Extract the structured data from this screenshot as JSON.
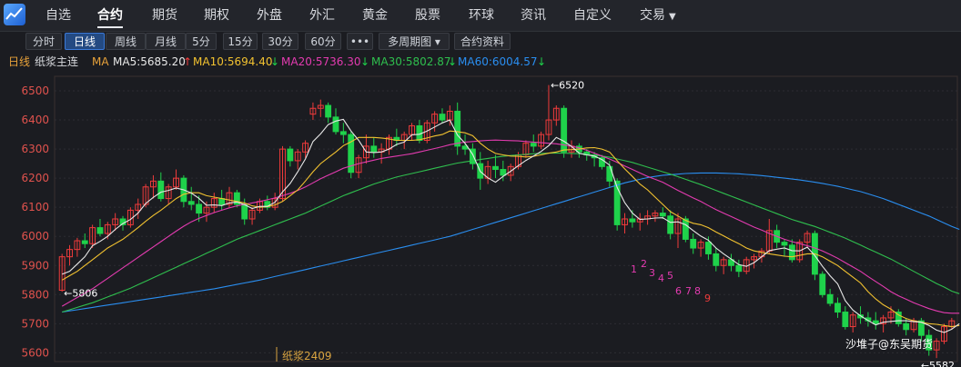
{
  "nav": {
    "items": [
      "自选",
      "合约",
      "期货",
      "期权",
      "外盘",
      "外汇",
      "黄金",
      "股票",
      "环球",
      "资讯",
      "自定义",
      "交易"
    ],
    "active": "合约"
  },
  "toolbar": {
    "expand_icon": "double-chevron-right-icon",
    "buttons": [
      "分时",
      "日线",
      "周线",
      "月线",
      "5分",
      "15分",
      "30分",
      "60分",
      "•••",
      "多周期图",
      "合约资料"
    ],
    "active": "日线"
  },
  "info": {
    "period": "日线",
    "contract": "纸浆主连",
    "ma_label": "MA",
    "ma5": "MA5:5685.20",
    "ma10": "MA10:5694.40",
    "ma20": "MA20:5736.30",
    "ma30": "MA30:5802.87",
    "ma60": "MA60:6004.57",
    "arrows": {
      "ma5": "↑",
      "ma10": "↓",
      "ma20": "↓",
      "ma30": "↓",
      "ma60": "↓"
    }
  },
  "colors": {
    "up": "#ef3b3b",
    "down": "#1fd24b",
    "ma5": "#e8e8e8",
    "ma10": "#f2c230",
    "ma20": "#e33bb0",
    "ma30": "#2fbf4e",
    "ma60": "#2a8ef0",
    "axis": "#e0524d"
  },
  "chart_data": {
    "type": "candlestick",
    "ylim": [
      5570,
      6550
    ],
    "y_ticks": [
      5600,
      5700,
      5800,
      5900,
      6000,
      6100,
      6200,
      6300,
      6400,
      6500
    ],
    "high_label": "←6520",
    "low_start_label": "←5806",
    "low_end_label": "←5582",
    "contract_label": "纸浆2409",
    "watermark": "沙堆子@东吴期货",
    "wave_labels": [
      "1",
      "2",
      "3",
      "4",
      "5",
      "6",
      "7",
      "8",
      "9"
    ],
    "candles": [
      [
        5815,
        5940,
        5810,
        5930
      ],
      [
        5930,
        5970,
        5900,
        5955
      ],
      [
        5955,
        5995,
        5930,
        5985
      ],
      [
        5985,
        6010,
        5960,
        5975
      ],
      [
        5975,
        6040,
        5960,
        6030
      ],
      [
        6030,
        6060,
        6000,
        6010
      ],
      [
        6010,
        6050,
        5990,
        6040
      ],
      [
        6040,
        6080,
        6020,
        6060
      ],
      [
        6060,
        6070,
        6020,
        6040
      ],
      [
        6040,
        6100,
        6030,
        6090
      ],
      [
        6090,
        6130,
        6060,
        6110
      ],
      [
        6110,
        6180,
        6100,
        6170
      ],
      [
        6170,
        6210,
        6130,
        6190
      ],
      [
        6190,
        6220,
        6120,
        6130
      ],
      [
        6130,
        6180,
        6110,
        6170
      ],
      [
        6170,
        6230,
        6160,
        6200
      ],
      [
        6200,
        6210,
        6100,
        6120
      ],
      [
        6120,
        6170,
        6090,
        6110
      ],
      [
        6110,
        6140,
        6050,
        6080
      ],
      [
        6080,
        6120,
        6050,
        6100
      ],
      [
        6100,
        6150,
        6080,
        6130
      ],
      [
        6130,
        6160,
        6090,
        6110
      ],
      [
        6110,
        6170,
        6100,
        6150
      ],
      [
        6150,
        6160,
        6100,
        6110
      ],
      [
        6110,
        6130,
        6040,
        6060
      ],
      [
        6060,
        6100,
        6040,
        6090
      ],
      [
        6090,
        6130,
        6080,
        6120
      ],
      [
        6120,
        6140,
        6090,
        6100
      ],
      [
        6100,
        6150,
        6090,
        6130
      ],
      [
        6130,
        6310,
        6120,
        6300
      ],
      [
        6300,
        6310,
        6240,
        6260
      ],
      [
        6260,
        6300,
        6230,
        6290
      ],
      [
        6290,
        6330,
        6270,
        6320
      ],
      [
        6420,
        6460,
        6400,
        6440
      ],
      [
        6440,
        6470,
        6410,
        6450
      ],
      [
        6450,
        6460,
        6390,
        6410
      ],
      [
        6410,
        6440,
        6350,
        6360
      ],
      [
        6360,
        6390,
        6320,
        6350
      ],
      [
        6350,
        6360,
        6200,
        6220
      ],
      [
        6220,
        6280,
        6200,
        6270
      ],
      [
        6270,
        6350,
        6250,
        6310
      ],
      [
        6310,
        6340,
        6270,
        6290
      ],
      [
        6290,
        6320,
        6250,
        6300
      ],
      [
        6300,
        6350,
        6280,
        6340
      ],
      [
        6340,
        6370,
        6310,
        6330
      ],
      [
        6330,
        6360,
        6300,
        6350
      ],
      [
        6350,
        6390,
        6330,
        6380
      ],
      [
        6380,
        6400,
        6320,
        6330
      ],
      [
        6330,
        6400,
        6320,
        6390
      ],
      [
        6390,
        6430,
        6360,
        6420
      ],
      [
        6420,
        6440,
        6390,
        6400
      ],
      [
        6400,
        6450,
        6380,
        6430
      ],
      [
        6430,
        6460,
        6280,
        6310
      ],
      [
        6310,
        6350,
        6280,
        6300
      ],
      [
        6300,
        6320,
        6230,
        6250
      ],
      [
        6250,
        6290,
        6160,
        6200
      ],
      [
        6200,
        6260,
        6180,
        6240
      ],
      [
        6240,
        6280,
        6200,
        6230
      ],
      [
        6230,
        6260,
        6190,
        6210
      ],
      [
        6210,
        6250,
        6190,
        6240
      ],
      [
        6240,
        6290,
        6230,
        6280
      ],
      [
        6280,
        6330,
        6270,
        6320
      ],
      [
        6320,
        6350,
        6290,
        6310
      ],
      [
        6310,
        6360,
        6300,
        6350
      ],
      [
        6350,
        6520,
        6330,
        6400
      ],
      [
        6400,
        6450,
        6380,
        6440
      ],
      [
        6440,
        6450,
        6270,
        6290
      ],
      [
        6290,
        6330,
        6270,
        6310
      ],
      [
        6310,
        6320,
        6270,
        6290
      ],
      [
        6290,
        6300,
        6260,
        6280
      ],
      [
        6280,
        6290,
        6240,
        6270
      ],
      [
        6270,
        6280,
        6230,
        6240
      ],
      [
        6240,
        6260,
        6170,
        6190
      ],
      [
        6190,
        6200,
        6020,
        6040
      ],
      [
        6040,
        6080,
        6010,
        6060
      ],
      [
        6060,
        6090,
        6030,
        6050
      ],
      [
        6050,
        6080,
        6020,
        6060
      ],
      [
        6060,
        6090,
        6040,
        6070
      ],
      [
        6070,
        6090,
        6050,
        6080
      ],
      [
        6080,
        6100,
        6060,
        6070
      ],
      [
        6070,
        6090,
        5990,
        6010
      ],
      [
        6010,
        6080,
        5960,
        6060
      ],
      [
        6060,
        6070,
        5980,
        5990
      ],
      [
        5990,
        6010,
        5940,
        5960
      ],
      [
        5960,
        5990,
        5930,
        5980
      ],
      [
        5980,
        6000,
        5920,
        5940
      ],
      [
        5940,
        5960,
        5880,
        5900
      ],
      [
        5900,
        5930,
        5870,
        5920
      ],
      [
        5920,
        5940,
        5880,
        5900
      ],
      [
        5900,
        5920,
        5860,
        5880
      ],
      [
        5880,
        5930,
        5870,
        5920
      ],
      [
        5920,
        5940,
        5890,
        5930
      ],
      [
        5930,
        5960,
        5910,
        5950
      ],
      [
        5950,
        6060,
        5940,
        6020
      ],
      [
        6020,
        6040,
        5960,
        5980
      ],
      [
        5980,
        5990,
        5930,
        5970
      ],
      [
        5970,
        5990,
        5910,
        5920
      ],
      [
        5920,
        5990,
        5910,
        5980
      ],
      [
        5980,
        6020,
        5960,
        6010
      ],
      [
        6010,
        6020,
        5850,
        5870
      ],
      [
        5870,
        5880,
        5790,
        5800
      ],
      [
        5800,
        5820,
        5760,
        5770
      ],
      [
        5770,
        5790,
        5720,
        5740
      ],
      [
        5740,
        5760,
        5680,
        5690
      ],
      [
        5690,
        5740,
        5670,
        5730
      ],
      [
        5730,
        5760,
        5700,
        5720
      ],
      [
        5720,
        5740,
        5690,
        5710
      ],
      [
        5710,
        5740,
        5680,
        5700
      ],
      [
        5700,
        5730,
        5670,
        5720
      ],
      [
        5720,
        5760,
        5700,
        5740
      ],
      [
        5740,
        5750,
        5690,
        5700
      ],
      [
        5700,
        5720,
        5660,
        5680
      ],
      [
        5680,
        5720,
        5670,
        5710
      ],
      [
        5710,
        5720,
        5640,
        5660
      ],
      [
        5660,
        5680,
        5590,
        5610
      ],
      [
        5610,
        5650,
        5582,
        5640
      ],
      [
        5640,
        5700,
        5630,
        5690
      ],
      [
        5690,
        5720,
        5680,
        5710
      ]
    ],
    "ma5": [
      5870,
      5880,
      5905,
      5930,
      5968,
      5983,
      6000,
      6024,
      6044,
      6058,
      6080,
      6113,
      6134,
      6152,
      6158,
      6166,
      6160,
      6149,
      6131,
      6107,
      6108,
      6106,
      6115,
      6118,
      6109,
      6096,
      6103,
      6103,
      6117,
      6153,
      6182,
      6222,
      6266,
      6326,
      6352,
      6384,
      6396,
      6402,
      6362,
      6330,
      6290,
      6288,
      6290,
      6300,
      6316,
      6324,
      6349,
      6351,
      6362,
      6376,
      6390,
      6400,
      6348,
      6320,
      6282,
      6223,
      6201,
      6186,
      6206,
      6224,
      6243,
      6261,
      6276,
      6292,
      6312,
      6340,
      6327,
      6309,
      6286,
      6280,
      6276,
      6264,
      6245,
      6168,
      6116,
      6080,
      6058,
      6060,
      6063,
      6064,
      6048,
      6050,
      6040,
      6020,
      6001,
      5987,
      5960,
      5940,
      5922,
      5903,
      5897,
      5910,
      5930,
      5951,
      5956,
      5960,
      5951,
      5950,
      5963,
      5934,
      5897,
      5865,
      5837,
      5779,
      5747,
      5727,
      5711,
      5696,
      5705,
      5708,
      5710,
      5710,
      5707,
      5705,
      5694,
      5678,
      5670,
      5681,
      5700
    ],
    "ma10": [
      5850,
      5865,
      5880,
      5900,
      5920,
      5940,
      5960,
      5975,
      5990,
      6010,
      6030,
      6052,
      6072,
      6090,
      6110,
      6130,
      6145,
      6150,
      6150,
      6140,
      6135,
      6130,
      6125,
      6120,
      6115,
      6105,
      6100,
      6102,
      6108,
      6120,
      6140,
      6160,
      6190,
      6222,
      6250,
      6270,
      6290,
      6312,
      6325,
      6340,
      6340,
      6340,
      6338,
      6335,
      6330,
      6330,
      6330,
      6332,
      6338,
      6345,
      6350,
      6362,
      6360,
      6356,
      6346,
      6320,
      6300,
      6285,
      6280,
      6276,
      6275,
      6273,
      6275,
      6280,
      6286,
      6290,
      6297,
      6298,
      6300,
      6304,
      6305,
      6300,
      6290,
      6260,
      6232,
      6206,
      6180,
      6160,
      6135,
      6110,
      6085,
      6070,
      6055,
      6045,
      6040,
      6030,
      6015,
      6002,
      5988,
      5975,
      5960,
      5950,
      5945,
      5940,
      5936,
      5932,
      5930,
      5935,
      5940,
      5940,
      5930,
      5915,
      5900,
      5880,
      5860,
      5840,
      5810,
      5785,
      5765,
      5750,
      5730,
      5718,
      5710,
      5705,
      5700,
      5698,
      5694,
      5690,
      5694
    ],
    "ma20": [
      5760,
      5775,
      5790,
      5805,
      5820,
      5838,
      5856,
      5874,
      5892,
      5910,
      5928,
      5946,
      5964,
      5982,
      6000,
      6018,
      6035,
      6050,
      6062,
      6072,
      6082,
      6090,
      6098,
      6105,
      6110,
      6115,
      6120,
      6126,
      6132,
      6140,
      6148,
      6158,
      6170,
      6184,
      6198,
      6210,
      6222,
      6234,
      6242,
      6250,
      6256,
      6262,
      6268,
      6272,
      6276,
      6280,
      6284,
      6290,
      6296,
      6302,
      6308,
      6315,
      6320,
      6324,
      6326,
      6328,
      6330,
      6331,
      6330,
      6329,
      6328,
      6326,
      6324,
      6322,
      6320,
      6318,
      6314,
      6310,
      6304,
      6296,
      6286,
      6276,
      6266,
      6254,
      6242,
      6230,
      6218,
      6206,
      6196,
      6186,
      6172,
      6158,
      6145,
      6132,
      6120,
      6106,
      6092,
      6080,
      6068,
      6056,
      6044,
      6032,
      6022,
      6010,
      6000,
      5990,
      5982,
      5975,
      5968,
      5960,
      5950,
      5938,
      5925,
      5910,
      5895,
      5880,
      5862,
      5845,
      5828,
      5810,
      5796,
      5784,
      5772,
      5762,
      5752,
      5744,
      5738,
      5736,
      5736
    ],
    "ma30": [
      5740,
      5748,
      5756,
      5764,
      5772,
      5782,
      5792,
      5802,
      5812,
      5822,
      5834,
      5846,
      5858,
      5870,
      5882,
      5894,
      5906,
      5918,
      5930,
      5942,
      5954,
      5966,
      5978,
      5990,
      6000,
      6010,
      6020,
      6030,
      6040,
      6050,
      6060,
      6070,
      6080,
      6092,
      6104,
      6116,
      6128,
      6140,
      6150,
      6160,
      6170,
      6180,
      6188,
      6196,
      6204,
      6210,
      6216,
      6222,
      6228,
      6234,
      6240,
      6246,
      6252,
      6256,
      6260,
      6264,
      6268,
      6272,
      6275,
      6278,
      6280,
      6282,
      6284,
      6285,
      6286,
      6286,
      6286,
      6285,
      6284,
      6282,
      6280,
      6276,
      6272,
      6266,
      6260,
      6254,
      6246,
      6238,
      6230,
      6222,
      6214,
      6205,
      6196,
      6187,
      6178,
      6168,
      6158,
      6148,
      6138,
      6128,
      6118,
      6108,
      6098,
      6088,
      6078,
      6068,
      6058,
      6050,
      6042,
      6034,
      6024,
      6014,
      6004,
      5994,
      5982,
      5970,
      5958,
      5946,
      5934,
      5922,
      5908,
      5894,
      5880,
      5866,
      5852,
      5838,
      5826,
      5812,
      5803
    ],
    "ma60": [
      5740,
      5744,
      5748,
      5752,
      5756,
      5760,
      5764,
      5768,
      5772,
      5776,
      5780,
      5784,
      5788,
      5792,
      5796,
      5800,
      5804,
      5808,
      5812,
      5816,
      5820,
      5825,
      5830,
      5835,
      5840,
      5845,
      5850,
      5856,
      5862,
      5868,
      5874,
      5880,
      5886,
      5892,
      5898,
      5904,
      5910,
      5916,
      5922,
      5928,
      5934,
      5940,
      5946,
      5952,
      5958,
      5964,
      5970,
      5976,
      5982,
      5988,
      5994,
      6000,
      6008,
      6016,
      6024,
      6032,
      6040,
      6048,
      6056,
      6064,
      6072,
      6080,
      6088,
      6096,
      6104,
      6112,
      6120,
      6128,
      6136,
      6144,
      6152,
      6160,
      6168,
      6176,
      6184,
      6190,
      6196,
      6202,
      6206,
      6210,
      6212,
      6214,
      6216,
      6217,
      6218,
      6218,
      6218,
      6217,
      6216,
      6215,
      6213,
      6211,
      6209,
      6206,
      6203,
      6200,
      6197,
      6194,
      6190,
      6186,
      6182,
      6177,
      6172,
      6166,
      6160,
      6154,
      6146,
      6138,
      6130,
      6120,
      6110,
      6100,
      6090,
      6080,
      6070,
      6058,
      6046,
      6034,
      6024
    ]
  }
}
